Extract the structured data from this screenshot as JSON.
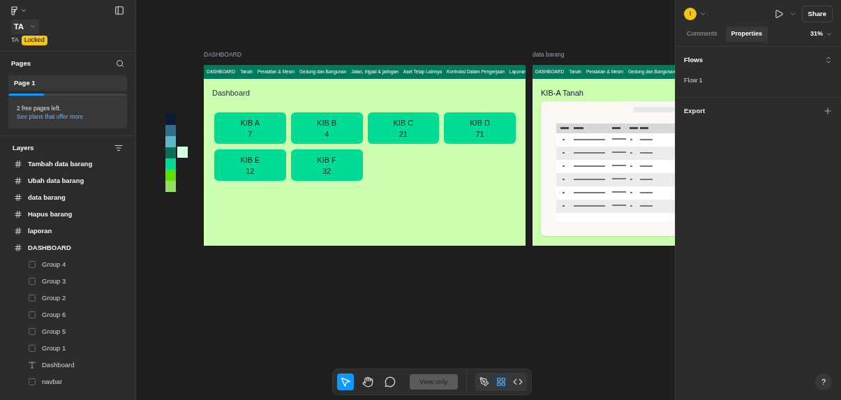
{
  "file": {
    "name": "TA",
    "subtitle": "TA",
    "badge": "Locked"
  },
  "pages": {
    "title": "Pages",
    "items": [
      {
        "label": "Page 1",
        "selected": true
      }
    ],
    "notice": {
      "level": 0.3,
      "text": "2 free pages left.",
      "link": "See plans that offer more"
    }
  },
  "layers": {
    "title": "Layers",
    "items": [
      {
        "kind": "frame",
        "label": "Tambah data barang"
      },
      {
        "kind": "frame",
        "label": "Ubah data barang"
      },
      {
        "kind": "frame",
        "label": "data barang"
      },
      {
        "kind": "frame",
        "label": "Hapus barang"
      },
      {
        "kind": "frame",
        "label": "laporan"
      },
      {
        "kind": "frame",
        "label": "DASHBOARD",
        "children": [
          {
            "kind": "group",
            "label": "Group 4"
          },
          {
            "kind": "group",
            "label": "Group 3"
          },
          {
            "kind": "group",
            "label": "Group 2"
          },
          {
            "kind": "group",
            "label": "Group 6"
          },
          {
            "kind": "group",
            "label": "Group 5"
          },
          {
            "kind": "group",
            "label": "Group 1"
          },
          {
            "kind": "text",
            "label": "Dashboard"
          },
          {
            "kind": "group",
            "label": "navbar"
          }
        ]
      }
    ]
  },
  "canvas": {
    "swatches": [
      {
        "color": "#0b1a3a"
      },
      {
        "color": "#2f6f8c"
      },
      {
        "color": "#5ab8c9"
      },
      {
        "color": "#0b6e58"
      },
      {
        "color": "#00dc96"
      },
      {
        "color": "#5ce000"
      },
      {
        "color": "#90de64"
      }
    ],
    "extra_swatch": {
      "color": "#d2ffe0"
    },
    "frames": [
      {
        "kind": "dashboard",
        "label": "DASHBOARD",
        "nav": [
          "DASHBOARD",
          "Tanah",
          "Peralatan & Mesin",
          "Gedung dan Bangunan",
          "Jalan, Irigasi & jaringan",
          "Aset Tetap Lainnya",
          "Kontruksi Dalam Pengerjaan",
          "Laporan"
        ],
        "heading": "Dashboard",
        "cards": [
          {
            "title": "KIB A",
            "value": "7"
          },
          {
            "title": "KIB B",
            "value": "4"
          },
          {
            "title": "KIB C",
            "value": "21"
          },
          {
            "title": "KIB D",
            "value": "71"
          },
          {
            "title": "KIB E",
            "value": "12"
          },
          {
            "title": "KIB F",
            "value": "32"
          }
        ]
      },
      {
        "kind": "table",
        "label": "data barang",
        "nav": [
          "DASHBOARD",
          "Tanah",
          "Peralatan & Mesin",
          "Gedung dan Bangunan"
        ],
        "heading": "KIB-A Tanah"
      }
    ]
  },
  "toolbar": {
    "tools": [
      {
        "kind": "move",
        "selected": true
      },
      {
        "kind": "hand",
        "selected": false
      },
      {
        "kind": "comment",
        "selected": false
      }
    ],
    "view_only": "View only",
    "modes": [
      {
        "kind": "draw",
        "selected": false
      },
      {
        "kind": "design",
        "selected": true
      },
      {
        "kind": "dev",
        "selected": false
      }
    ]
  },
  "right": {
    "avatar": "I",
    "share": "Share",
    "tabs": [
      {
        "label": "Comments",
        "selected": false
      },
      {
        "label": "Properties",
        "selected": true
      }
    ],
    "zoom": "31%",
    "flows": {
      "title": "Flows",
      "items": [
        "Flow 1"
      ]
    },
    "export": {
      "title": "Export"
    }
  },
  "help": "?"
}
